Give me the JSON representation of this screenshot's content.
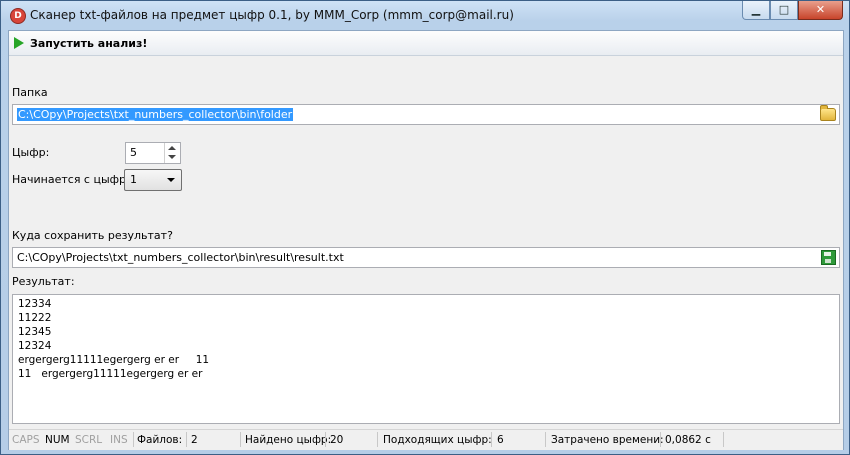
{
  "window": {
    "title": "Сканер txt-файлов на предмет цыфр 0.1,  by MMM_Corp (mmm_corp@mail.ru)",
    "icon": "app-icon"
  },
  "toolbar": {
    "run_label": "Запустить анализ!"
  },
  "folder": {
    "label": "Папка",
    "value": "C:\\COpy\\Projects\\txt_numbers_collector\\bin\\folder"
  },
  "digits": {
    "label": "Цыфр:",
    "value": "5"
  },
  "starts_with": {
    "label": "Начинается с цыфр:",
    "value": "1"
  },
  "save": {
    "label": "Куда сохранить результат?",
    "value": "C:\\COpy\\Projects\\txt_numbers_collector\\bin\\result\\result.txt"
  },
  "result": {
    "label": "Результат:",
    "lines": [
      "12334",
      "11222",
      "12345",
      "12324",
      "ergergerg11111egergerg er er     11",
      "11   ergergerg11111egergerg er er"
    ]
  },
  "status": {
    "caps": "CAPS",
    "num": "NUM",
    "scrl": "SCRL",
    "ins": "INS",
    "files_label": "Файлов:",
    "files_value": "2",
    "found_label": "Найдено цыфр:",
    "found_value": "20",
    "matching_label": "Подходящих цыфр:",
    "matching_value": "6",
    "time_label": "Затрачено времени:",
    "time_value": "0,0862 с"
  }
}
